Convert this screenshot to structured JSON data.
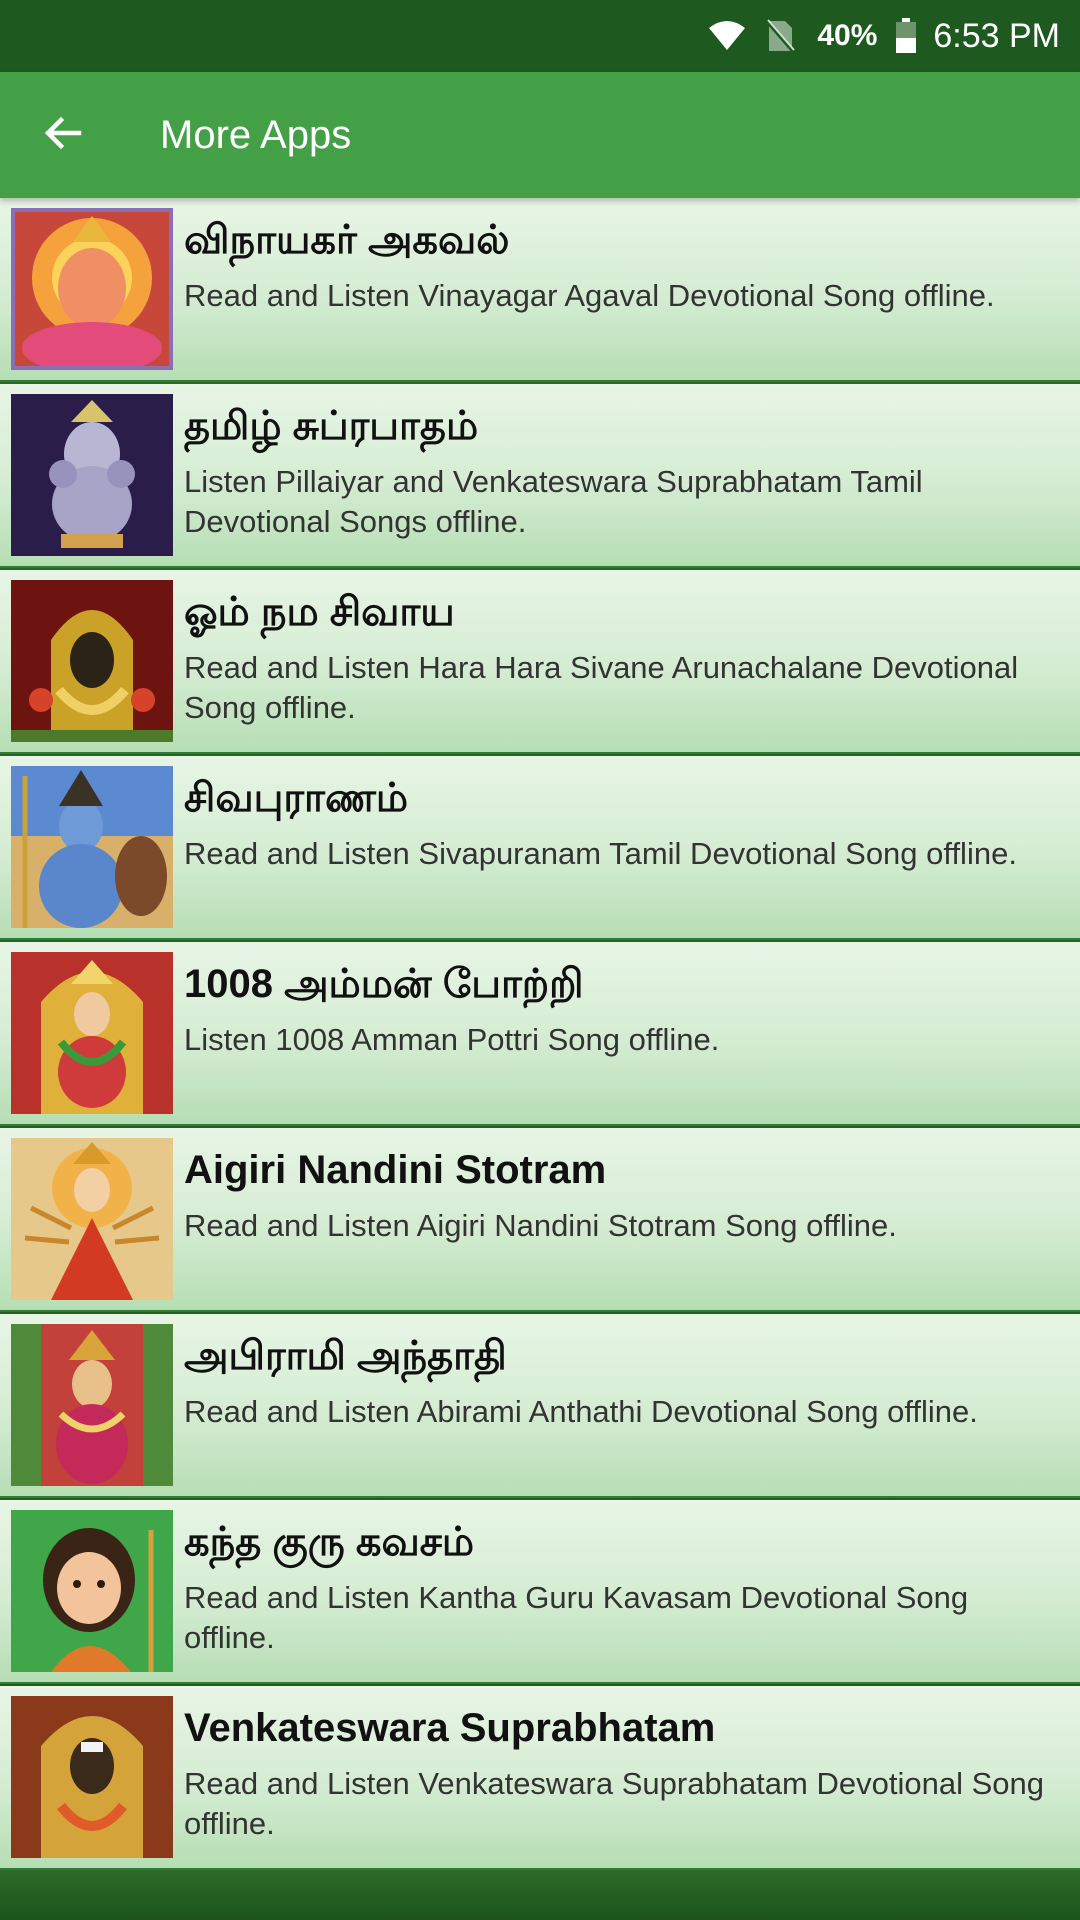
{
  "status": {
    "battery_pct": "40%",
    "time": "6:53 PM",
    "icons": [
      "wifi-icon",
      "no-sim-icon",
      "battery-icon"
    ]
  },
  "appbar": {
    "back_icon": "arrow-back-icon",
    "title": "More Apps"
  },
  "apps": [
    {
      "title": "விநாயகர் அகவல்",
      "desc": "Read and Listen Vinayagar Agaval Devotional Song offline.",
      "art": "ganesha-art"
    },
    {
      "title": "தமிழ் சுப்ரபாதம்",
      "desc": "Listen Pillaiyar and Venkateswara Suprabhatam Tamil Devotional Songs offline.",
      "art": "ganesha-blue-art"
    },
    {
      "title": "ஓம் நம சிவாய",
      "desc": "Read and Listen Hara Hara Sivane Arunachalane Devotional Song offline.",
      "art": "deity-gold-art"
    },
    {
      "title": "சிவபுராணம்",
      "desc": "Read and Listen Sivapuranam Tamil Devotional Song offline.",
      "art": "shiva-art"
    },
    {
      "title": "1008 அம்மன் போற்றி",
      "desc": "Listen 1008 Amman Pottri Song offline.",
      "art": "amman-art"
    },
    {
      "title": "Aigiri Nandini Stotram",
      "desc": "Read and Listen Aigiri Nandini Stotram Song offline.",
      "art": "durga-art"
    },
    {
      "title": "அபிராமி அந்தாதி",
      "desc": "Read and Listen Abirami Anthathi Devotional Song offline.",
      "art": "abirami-art"
    },
    {
      "title": "கந்த குரு கவசம்",
      "desc": "Read and Listen Kantha Guru Kavasam Devotional Song offline.",
      "art": "murugan-art"
    },
    {
      "title": "Venkateswara Suprabhatam",
      "desc": "Read and Listen Venkateswara Suprabhatam Devotional Song offline.",
      "art": "venkateswara-art"
    }
  ],
  "colors": {
    "status_bar": "#1e5a1f",
    "app_bar": "#43a047",
    "item_top": "#e8f5e6",
    "item_bottom": "#b6deb4",
    "divider": "#2f7d32"
  }
}
